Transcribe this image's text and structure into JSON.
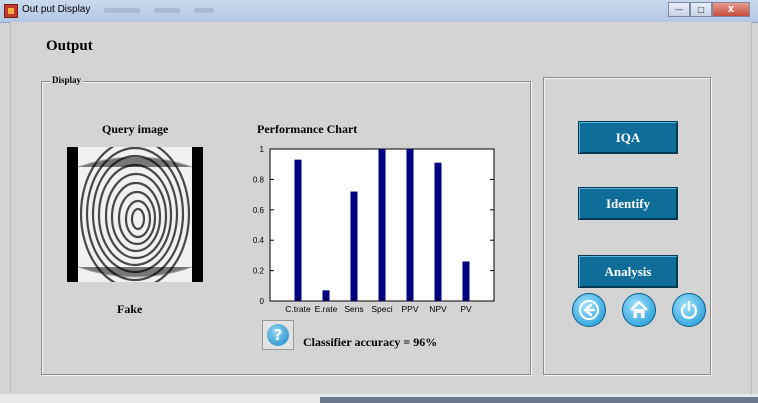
{
  "window": {
    "title": "Out put Display"
  },
  "header": {
    "title": "Output"
  },
  "display_panel": {
    "label": "Display",
    "query_label": "Query image",
    "result_label": "Fake",
    "chart_title": "Performance Chart",
    "accuracy_text": "Classifier accuracy = 96%"
  },
  "chart_data": {
    "type": "bar",
    "title": "",
    "categories": [
      "C.trate",
      "E.rate",
      "Sens",
      "Speci",
      "PPV",
      "NPV",
      "PV"
    ],
    "values": [
      0.93,
      0.07,
      0.72,
      1.0,
      1.0,
      0.91,
      0.26
    ],
    "ylim": [
      0,
      1
    ],
    "yticks": [
      0,
      0.2,
      0.4,
      0.6,
      0.8,
      1
    ],
    "bar_color": "#000080",
    "grid": false
  },
  "actions": {
    "iqa_label": "IQA",
    "identify_label": "Identify",
    "analysis_label": "Analysis"
  },
  "nav": {
    "icons": [
      "back-arrow-icon",
      "home-icon",
      "power-icon"
    ]
  },
  "colors": {
    "button": "#0e6e99",
    "window_bg": "#d4d4d4"
  }
}
